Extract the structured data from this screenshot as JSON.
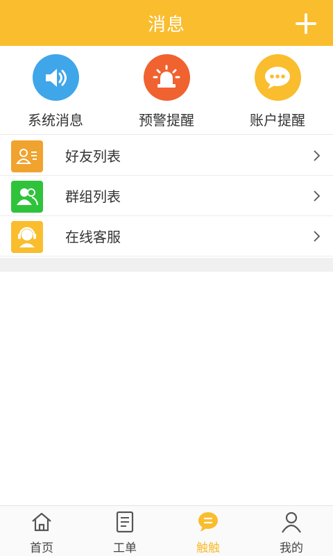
{
  "header": {
    "title": "消息",
    "add_icon": "plus-icon"
  },
  "shortcuts": [
    {
      "label": "系统消息",
      "icon": "speaker-icon",
      "color": "#3fa6ea"
    },
    {
      "label": "预警提醒",
      "icon": "alarm-light-icon",
      "color": "#f0622f"
    },
    {
      "label": "账户提醒",
      "icon": "chat-bubble-icon",
      "color": "#f9bd2e"
    }
  ],
  "list": [
    {
      "label": "好友列表",
      "icon": "contact-list-icon",
      "color": "#f0a32e"
    },
    {
      "label": "群组列表",
      "icon": "group-icon",
      "color": "#2fc33b"
    },
    {
      "label": "在线客服",
      "icon": "headset-icon",
      "color": "#f9bd2e"
    }
  ],
  "nav": [
    {
      "label": "首页",
      "icon": "home-icon"
    },
    {
      "label": "工单",
      "icon": "document-icon"
    },
    {
      "label": "触触",
      "icon": "message-icon",
      "active": true
    },
    {
      "label": "我的",
      "icon": "person-icon"
    }
  ],
  "colors": {
    "accent": "#f9bd2e",
    "text": "#333333"
  }
}
